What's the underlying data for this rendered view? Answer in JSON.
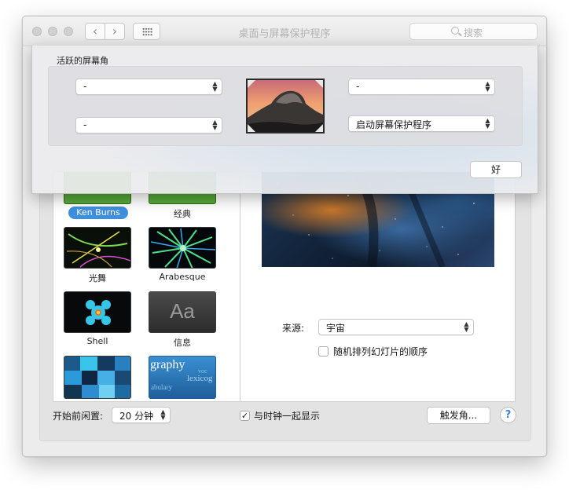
{
  "window": {
    "title": "桌面与屏幕保护程序",
    "search_placeholder": "搜索"
  },
  "hot_corners_sheet": {
    "group_title": "活跃的屏幕角",
    "top_left": "-",
    "top_right": "-",
    "bottom_left": "-",
    "bottom_right": "启动屏幕保护程序",
    "ok_label": "好"
  },
  "screensavers": [
    {
      "label": "Ken Burns",
      "selected": true
    },
    {
      "label": "经典",
      "selected": false
    },
    {
      "label": "光舞",
      "selected": false
    },
    {
      "label": "Arabesque",
      "selected": false
    },
    {
      "label": "Shell",
      "selected": false
    },
    {
      "label": "信息",
      "selected": false
    }
  ],
  "thumbnail_text": {
    "info_glyph": "Aa",
    "word_cloud": "graphy",
    "word_cloud_small_1": "lexicog",
    "word_cloud_small_2": "abulary",
    "word_cloud_small_3": "voc"
  },
  "options": {
    "source_label": "来源:",
    "source_value": "宇宙",
    "shuffle_label": "随机排列幻灯片的顺序",
    "shuffle_checked": false
  },
  "bottom": {
    "start_after_label": "开始前闲置:",
    "start_after_value": "20 分钟",
    "show_clock_label": "与时钟一起显示",
    "show_clock_checked": true,
    "hot_corners_button": "触发角...",
    "help_glyph": "?"
  },
  "colors": {
    "selection_blue": "#3f8fdf",
    "help_blue": "#3b86e0"
  }
}
